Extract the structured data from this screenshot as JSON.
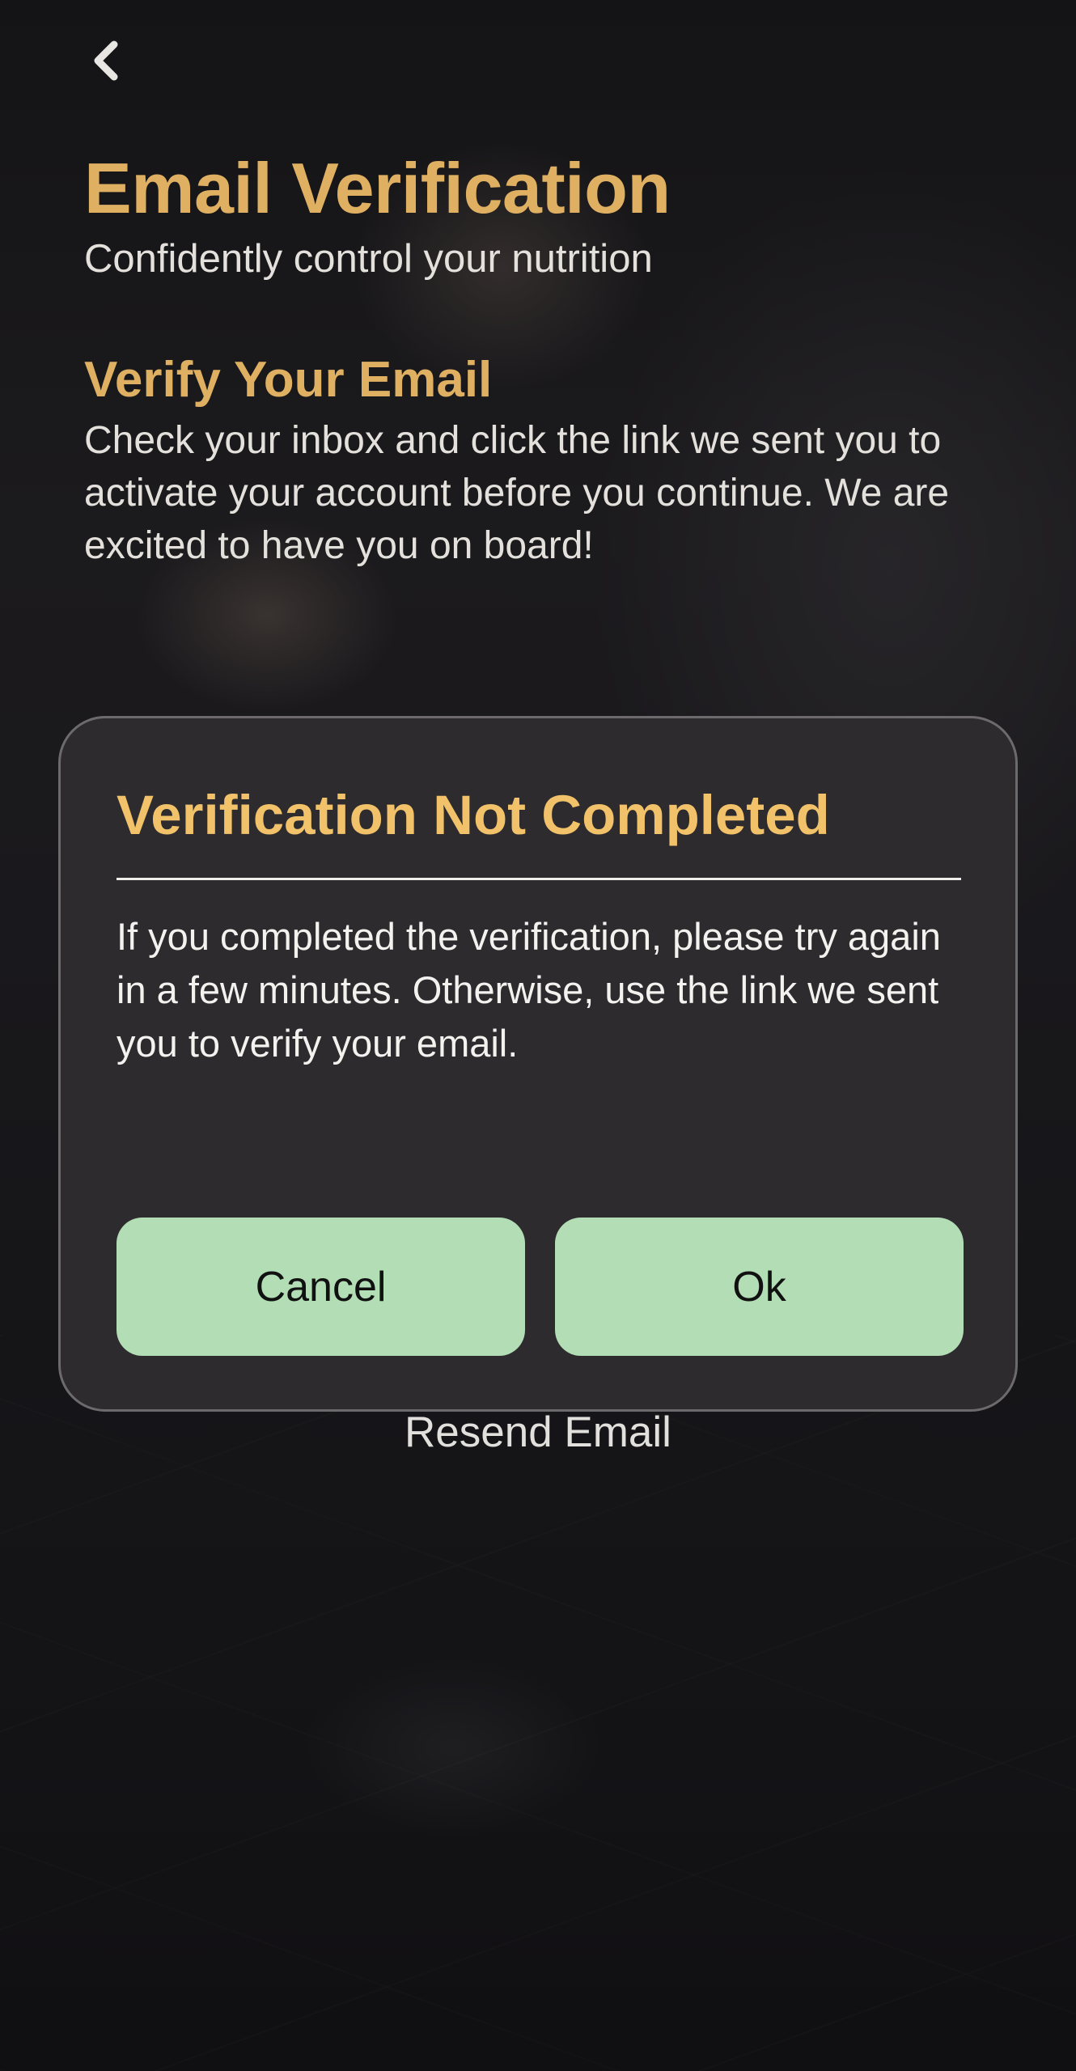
{
  "header": {
    "back_icon": "chevron-left-icon",
    "title": "Email Verification",
    "subtitle": "Confidently control your nutrition"
  },
  "verify_section": {
    "heading": "Verify Your Email",
    "body": "Check your inbox and click the link we sent you to activate your account before you continue. We are excited to have you on board!"
  },
  "resend_link": "Resend Email",
  "dialog": {
    "title": "Verification Not Completed",
    "message": "If you completed the verification, please try again in a few minutes. Otherwise, use the link we sent you to verify your email.",
    "cancel_label": "Cancel",
    "ok_label": "Ok"
  },
  "colors": {
    "accent_gold": "#dfb062",
    "dialog_title_gold": "#f1c26a",
    "button_green": "#b2ddb5",
    "dialog_background": "#2d2b2e"
  }
}
